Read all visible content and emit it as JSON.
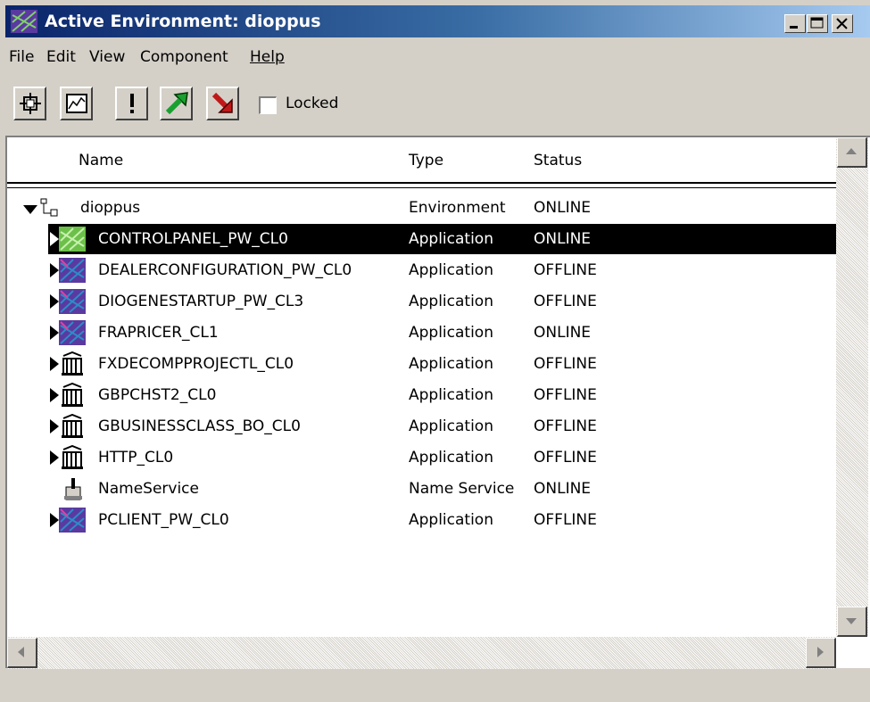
{
  "window": {
    "title": "Active Environment: dioppus"
  },
  "menu": [
    "File",
    "Edit",
    "View",
    "Component",
    "Help"
  ],
  "toolbar": {
    "locked_label": "Locked",
    "locked_checked": false
  },
  "columns": {
    "name": "Name",
    "type": "Type",
    "status": "Status"
  },
  "rows": [
    {
      "name": "dioppus",
      "type": "Environment",
      "status": "ONLINE",
      "icon": "environment-icon"
    },
    {
      "name": "CONTROLPANEL_PW_CL0",
      "type": "Application",
      "status": "ONLINE",
      "icon": "app-online-icon",
      "selected": true
    },
    {
      "name": "DEALERCONFIGURATION_PW_CL0",
      "type": "Application",
      "status": "OFFLINE",
      "icon": "app-offline-icon"
    },
    {
      "name": "DIOGENESTARTUP_PW_CL3",
      "type": "Application",
      "status": "OFFLINE",
      "icon": "app-offline-icon"
    },
    {
      "name": "FRAPRICER_CL1",
      "type": "Application",
      "status": "ONLINE",
      "icon": "app-offline-icon"
    },
    {
      "name": "FXDECOMPPROJECTL_CL0",
      "type": "Application",
      "status": "OFFLINE",
      "icon": "building-icon"
    },
    {
      "name": "GBPCHST2_CL0",
      "type": "Application",
      "status": "OFFLINE",
      "icon": "building-icon"
    },
    {
      "name": "GBUSINESSCLASS_BO_CL0",
      "type": "Application",
      "status": "OFFLINE",
      "icon": "building-icon"
    },
    {
      "name": "HTTP_CL0",
      "type": "Application",
      "status": "OFFLINE",
      "icon": "building-icon"
    },
    {
      "name": "NameService",
      "type": "Name Service",
      "status": "ONLINE",
      "icon": "name-service-icon"
    },
    {
      "name": "PCLIENT_PW_CL0",
      "type": "Application",
      "status": "OFFLINE",
      "icon": "app-offline-icon"
    }
  ],
  "colors": {
    "title_gradient_start": "#0a246a",
    "title_gradient_end": "#a6caf0",
    "selection": "#000000",
    "app_online": "#6cc04a",
    "app_offline": "#5a3aa0"
  }
}
